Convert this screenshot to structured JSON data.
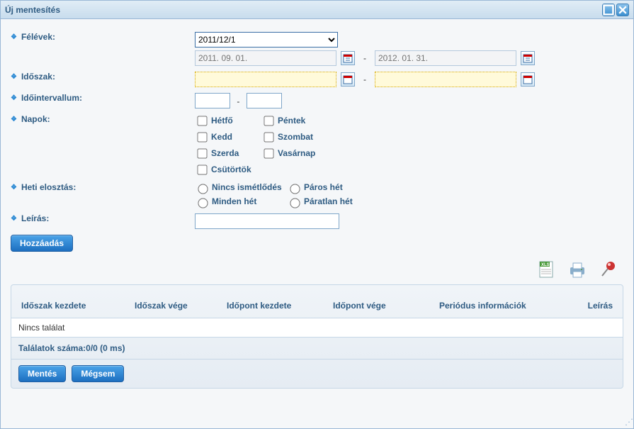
{
  "window": {
    "title": "Új mentesítés",
    "maximize_icon": "maximize",
    "close_icon": "close"
  },
  "form": {
    "semester": {
      "label": "Félévek:",
      "selected": "2011/12/1"
    },
    "semester_dates": {
      "from_placeholder": "2011. 09. 01.",
      "to_placeholder": "2012. 01. 31.",
      "sep": "-"
    },
    "period": {
      "label": "Időszak:",
      "from": "",
      "to": "",
      "sep": "-"
    },
    "interval": {
      "label": "Időintervallum:",
      "from": "",
      "to": "",
      "sep": "-"
    },
    "days": {
      "label": "Napok:",
      "items": [
        "Hétfő",
        "Kedd",
        "Szerda",
        "Csütörtök",
        "Péntek",
        "Szombat",
        "Vasárnap"
      ]
    },
    "weekly": {
      "label": "Heti elosztás:",
      "options": [
        "Nincs ismétlődés",
        "Minden hét",
        "Páros hét",
        "Páratlan hét"
      ]
    },
    "description": {
      "label": "Leírás:",
      "value": ""
    },
    "add_button": "Hozzáadás"
  },
  "toolbar": {
    "export_xls": "xls-export",
    "print": "print",
    "pin": "pin"
  },
  "table": {
    "columns": [
      "Időszak kezdete",
      "Időszak vége",
      "Időpont kezdete",
      "Időpont vége",
      "Periódus információk",
      "Leírás"
    ],
    "empty_text": "Nincs találat",
    "footer": "Találatok száma:0/0 (0 ms)"
  },
  "actions": {
    "save": "Mentés",
    "cancel": "Mégsem"
  }
}
